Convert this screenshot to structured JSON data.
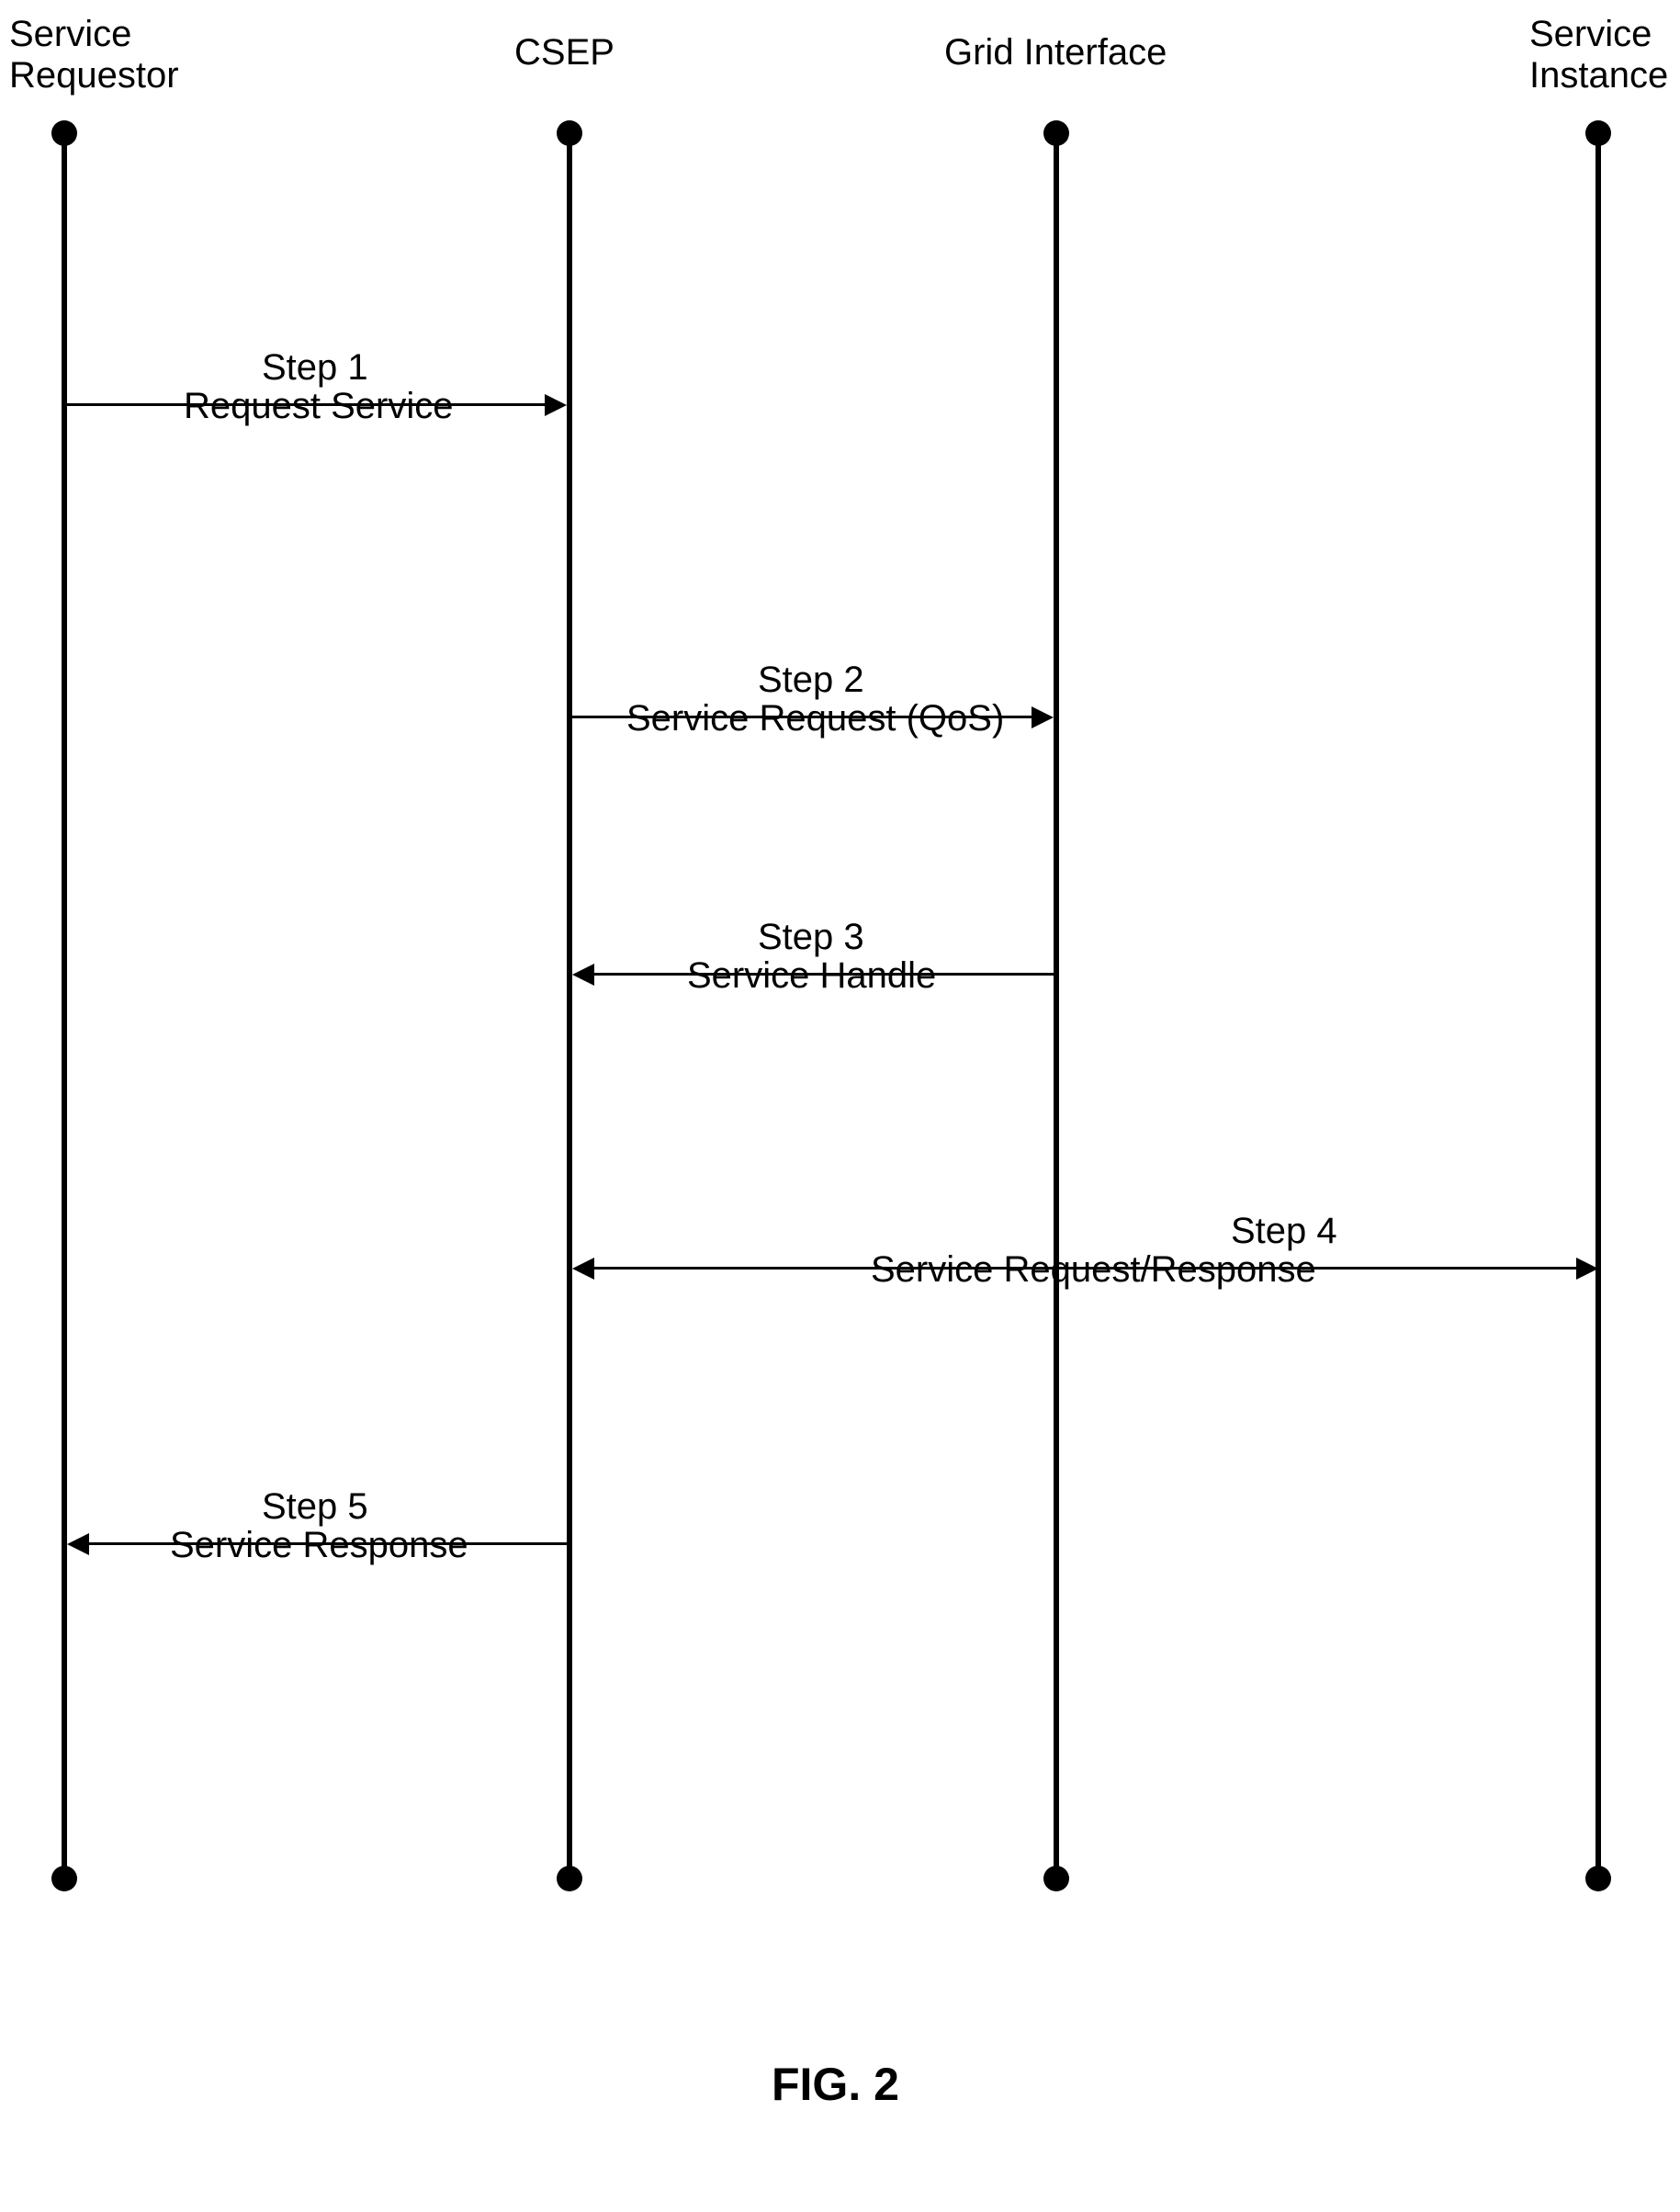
{
  "participants": {
    "p1": {
      "line1": "Service",
      "line2": "Requestor"
    },
    "p2": {
      "label": "CSEP"
    },
    "p3": {
      "label": "Grid Interface"
    },
    "p4": {
      "line1": "Service",
      "line2": "Instance"
    }
  },
  "messages": {
    "m1": {
      "step": "Step 1",
      "label": "Request Service"
    },
    "m2": {
      "step": "Step 2",
      "label": "Service Request (QoS)"
    },
    "m3": {
      "step": "Step 3",
      "label": "Service Handle"
    },
    "m4": {
      "step": "Step 4",
      "label": "Service Request/Response"
    },
    "m5": {
      "step": "Step 5",
      "label": "Service Response"
    }
  },
  "caption": "FIG. 2"
}
